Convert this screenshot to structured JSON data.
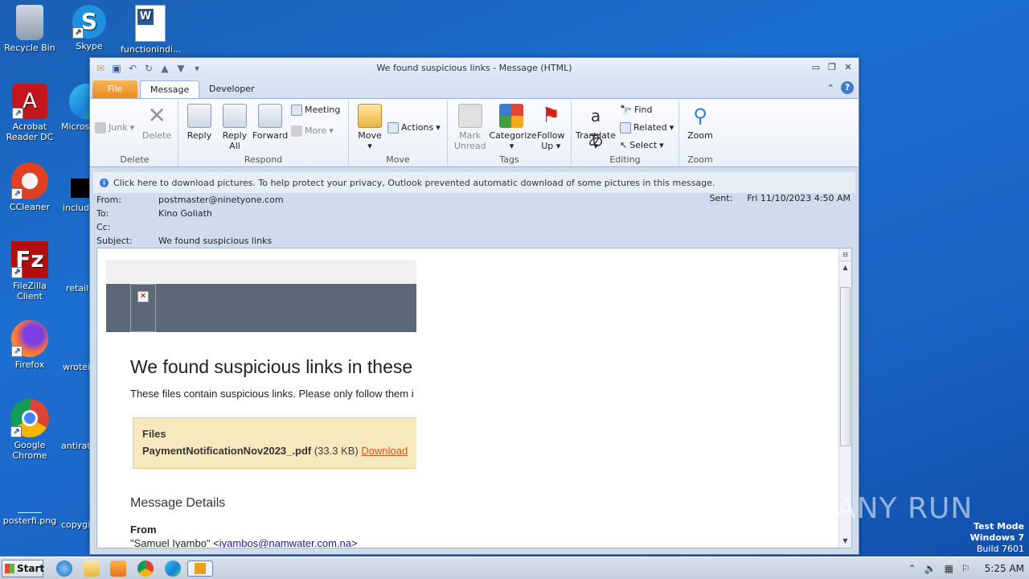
{
  "desktop": {
    "icons": [
      {
        "label": "Recycle Bin",
        "icon": "recycle-bin-icon"
      },
      {
        "label": "Skype",
        "icon": "skype-icon"
      },
      {
        "label": "functionindi...",
        "icon": "word-doc-icon"
      },
      {
        "label": "Acrobat Reader DC",
        "icon": "acrobat-icon"
      },
      {
        "label": "Microso",
        "icon": "edge-icon"
      },
      {
        "label": "CCleaner",
        "icon": "ccleaner-icon"
      },
      {
        "label": "includin",
        "icon": "black-file-icon"
      },
      {
        "label": "FileZilla Client",
        "icon": "filezilla-icon"
      },
      {
        "label": "retailt",
        "icon": "file-icon"
      },
      {
        "label": "Firefox",
        "icon": "firefox-icon"
      },
      {
        "label": "wroteir",
        "icon": "file-icon"
      },
      {
        "label": "Google Chrome",
        "icon": "chrome-icon"
      },
      {
        "label": "antirati",
        "icon": "file-icon"
      },
      {
        "label": "posterfi.png",
        "icon": "png-file-icon"
      },
      {
        "label": "copygi",
        "icon": "file-icon"
      }
    ]
  },
  "window": {
    "title": "We found suspicious links  -  Message (HTML)",
    "tabs": {
      "file": "File",
      "message": "Message",
      "developer": "Developer"
    }
  },
  "ribbon": {
    "delete_group": {
      "label": "Delete",
      "junk": "Junk",
      "delete": "Delete"
    },
    "respond_group": {
      "label": "Respond",
      "reply": "Reply",
      "reply_all_1": "Reply",
      "reply_all_2": "All",
      "forward": "Forward",
      "meeting": "Meeting",
      "more": "More"
    },
    "move_group": {
      "label": "Move",
      "move": "Move",
      "actions": "Actions"
    },
    "tags_group": {
      "label": "Tags",
      "mark_unread_1": "Mark",
      "mark_unread_2": "Unread",
      "categorize": "Categorize",
      "follow_up_1": "Follow",
      "follow_up_2": "Up"
    },
    "editing_group": {
      "label": "Editing",
      "translate": "Translate",
      "find": "Find",
      "related": "Related",
      "select": "Select"
    },
    "zoom_group": {
      "label": "Zoom",
      "zoom": "Zoom"
    }
  },
  "message": {
    "infobar": "Click here to download pictures. To help protect your privacy, Outlook prevented automatic download of some pictures in this message.",
    "from_label": "From:",
    "from": "postmaster@ninetyone.com",
    "to_label": "To:",
    "to": "Kino Goliath",
    "cc_label": "Cc:",
    "subject_label": "Subject:",
    "subject": "We found suspicious links",
    "sent_label": "Sent:",
    "sent": "Fri 11/10/2023 4:50 AM"
  },
  "body": {
    "heading": "We found suspicious links in these f",
    "paragraph": "These files contain suspicious links. Please only follow them i",
    "files_title": "Files",
    "file_name": "PaymentNotificationNov2023_.pdf",
    "file_size": "(33.3 KB)",
    "download": "Download",
    "details_title": "Message Details",
    "from_label": "From",
    "from_name": "\"Samuel Iyambo\" <",
    "from_email": "iyambos@namwater.com.na",
    "from_end": ">"
  },
  "taskbar": {
    "start": "Start",
    "clock": "5:25 AM"
  },
  "overlay": {
    "watermark": "ANY RUN",
    "test_mode_1": "Test Mode",
    "test_mode_2": "Windows 7",
    "test_mode_3": "Build 7601"
  }
}
